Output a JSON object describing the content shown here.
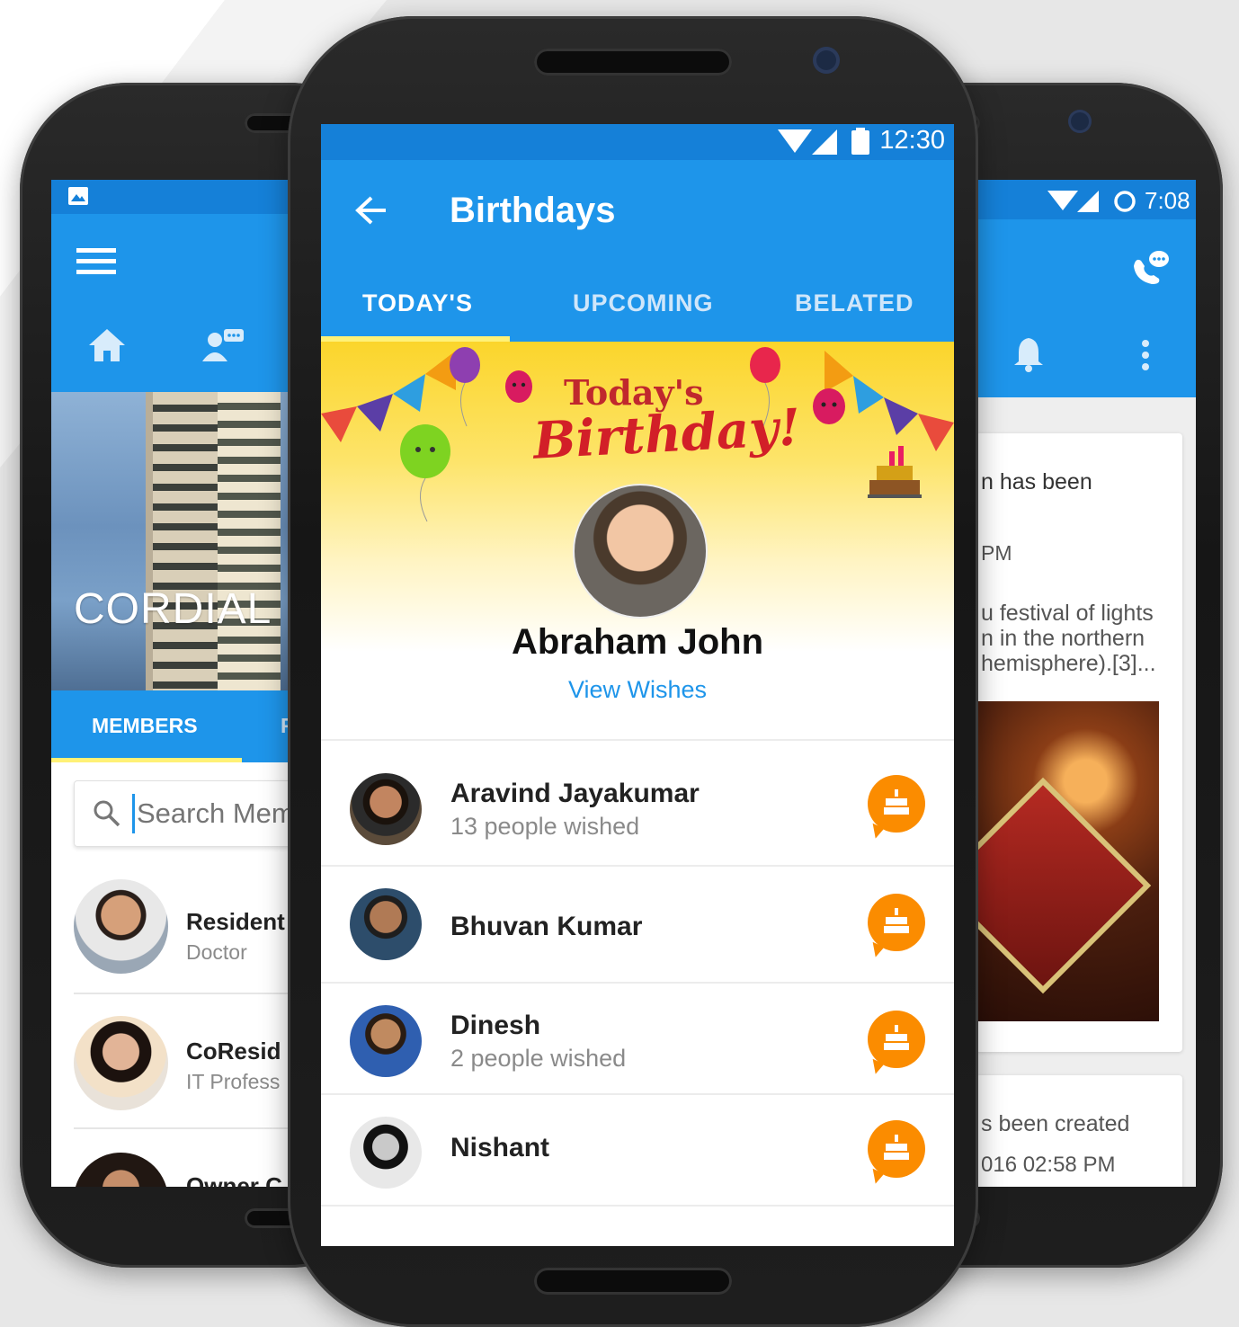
{
  "left_screen": {
    "brand_name": "CORDIAL",
    "tabs": [
      "MEMBERS",
      "F"
    ],
    "search": {
      "placeholder": "Search Mem"
    },
    "members": [
      {
        "name": "Resident",
        "role": "Doctor"
      },
      {
        "name": "CoResid",
        "role": "IT Profess"
      },
      {
        "name": "Owner C",
        "role": ""
      }
    ]
  },
  "center_screen": {
    "status_time": "12:30",
    "title": "Birthdays",
    "tabs": [
      "TODAY'S",
      "UPCOMING",
      "BELATED"
    ],
    "active_tab": "TODAY'S",
    "banner": {
      "headline_top": "Today's",
      "headline_bottom": "Birthday!",
      "person": "Abraham John",
      "link": "View Wishes"
    },
    "people": [
      {
        "name": "Aravind Jayakumar",
        "sub": "13 people wished"
      },
      {
        "name": "Bhuvan Kumar",
        "sub": ""
      },
      {
        "name": "Dinesh",
        "sub": "2 people wished"
      },
      {
        "name": "Nishant",
        "sub": ""
      }
    ]
  },
  "right_screen": {
    "status_time": "7:08",
    "post1": {
      "line1": "n has been",
      "time": "PM",
      "text1": "u festival of lights",
      "text2": "n in the northern",
      "text3": "hemisphere).[3]..."
    },
    "post2": {
      "line1": "s been created",
      "time": "016 02:58 PM"
    }
  },
  "colors": {
    "primary": "#1e95ea",
    "primary_dark": "#1580d8",
    "accent": "#fb8c00",
    "tab_indicator": "#fff176"
  }
}
